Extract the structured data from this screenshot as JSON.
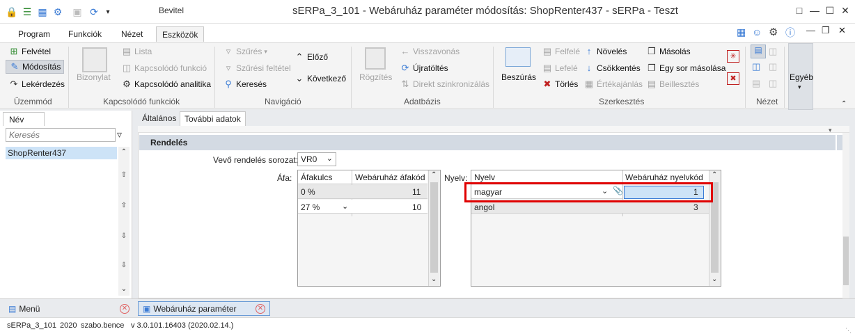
{
  "titlebar": {
    "ribbon_context": "Bevitel",
    "window_title": "sERPa_3_101 - Webáruház paraméter módosítás: ShopRenter437 - sERPa - Teszt"
  },
  "menu": {
    "tabs": [
      "Program",
      "Funkciók",
      "Nézet",
      "Eszközök"
    ],
    "active": "Eszközök"
  },
  "ribbon": {
    "uzemmod": {
      "felvetel": "Felvétel",
      "modositas": "Módosítás",
      "lekerdezes": "Lekérdezés",
      "group": "Üzemmód"
    },
    "kapcsolodo": {
      "bizonylat": "Bizonylat",
      "lista": "Lista",
      "kapcsolodo_funkcio": "Kapcsolódó funkció",
      "kapcsolodo_analitika": "Kapcsolódó analitika",
      "group": "Kapcsolódó funkciók"
    },
    "navigacio": {
      "szures": "Szűrés",
      "szuresi_feltetel": "Szűrési feltétel",
      "kereses": "Keresés",
      "elozo": "Előző",
      "kovetkezo": "Következő",
      "group": "Navigáció"
    },
    "adatbazis": {
      "rogzites": "Rögzítés",
      "visszavonas": "Visszavonás",
      "ujratoltes": "Újratöltés",
      "direkt": "Direkt szinkronizálás",
      "group": "Adatbázis"
    },
    "szerkesztes": {
      "beszuras": "Beszúrás",
      "felfele": "Felfelé",
      "lefele": "Lefelé",
      "torles": "Törlés",
      "noveles": "Növelés",
      "csokkentes": "Csökkentés",
      "ertekajanlas": "Értékajánlás",
      "masolas": "Másolás",
      "egy_sor": "Egy sor másolása",
      "beillesztes": "Beillesztés",
      "group": "Szerkesztés"
    },
    "nezet": {
      "group": "Nézet"
    },
    "egyeb": {
      "label": "Egyéb"
    }
  },
  "left_panel": {
    "tab": "Név",
    "search_placeholder": "Keresés",
    "items": [
      "ShopRenter437"
    ]
  },
  "main": {
    "tabs": [
      "Általános",
      "További adatok"
    ],
    "active_tab": "További adatok",
    "section_title": "Rendelés",
    "vevo_label": "Vevő rendelés sorozat:",
    "vevo_value": "VR0",
    "afa_label": "Áfa:",
    "afa_columns": [
      "Áfakulcs",
      "Webáruház áfakód"
    ],
    "afa_rows": [
      {
        "kulcs": "0 %",
        "kod": "11"
      },
      {
        "kulcs": "27 %",
        "kod": "10"
      }
    ],
    "nyelv_label": "Nyelv:",
    "nyelv_columns": [
      "Nyelv",
      "Webáruház nyelvkód"
    ],
    "nyelv_rows": [
      {
        "nyelv": "magyar",
        "kod": "1"
      },
      {
        "nyelv": "angol",
        "kod": "3"
      }
    ]
  },
  "bottom_tabs": [
    "Menü",
    "Webáruház paraméter"
  ],
  "status": {
    "db": "sERPa_3_101",
    "year": "2020",
    "user": "szabo.bence",
    "version": "v 3.0.101.16403 (2020.02.14.)"
  },
  "colors": {
    "accent_blue": "#3a7bd5",
    "highlight_red": "#e00000",
    "selected_row": "#cde3f7"
  }
}
